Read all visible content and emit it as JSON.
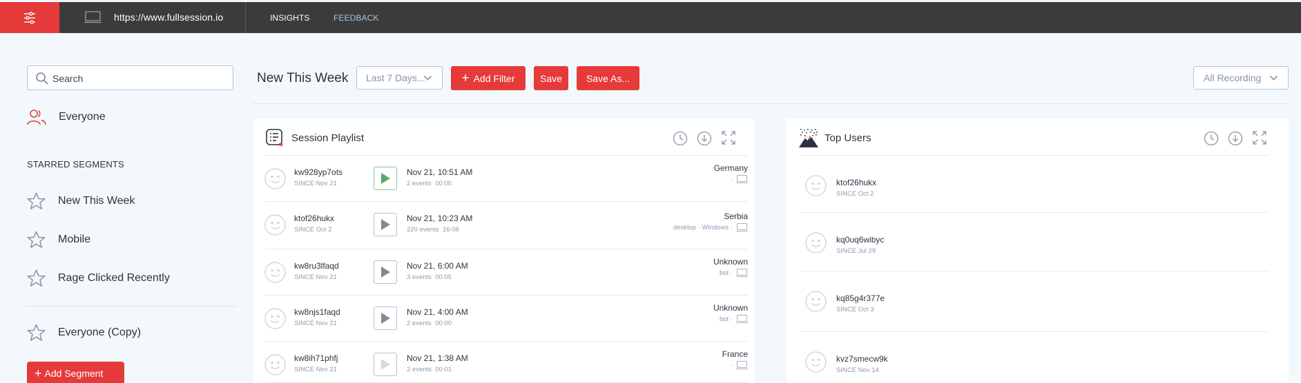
{
  "topbar": {
    "url": "https://www.fullsession.io",
    "tabs": [
      "INSIGHTS",
      "FEEDBACK"
    ]
  },
  "sidebar": {
    "search_placeholder": "Search",
    "everyone_label": "Everyone",
    "starred_heading": "STARRED SEGMENTS",
    "starred": [
      "New This Week",
      "Mobile",
      "Rage Clicked Recently"
    ],
    "other": [
      "Everyone (Copy)"
    ],
    "add_segment_label": "Add Segment"
  },
  "toolbar": {
    "title": "New This Week",
    "date_range": "Last 7 Days...",
    "add_filter_label": "Add Filter",
    "save_label": "Save",
    "save_as_label": "Save As...",
    "recording_filter": "All Recording"
  },
  "session_playlist": {
    "title": "Session Playlist",
    "rows": [
      {
        "user": "kw928yp7ots",
        "since": "SINCE Nov 21",
        "time": "Nov 21, 10:51 AM",
        "events": "2 events  00:00",
        "country": "Germany",
        "device": "·",
        "active": true
      },
      {
        "user": "ktof26hukx",
        "since": "SINCE Oct 2",
        "time": "Nov 21, 10:23 AM",
        "events": "220 events  16:08",
        "country": "Serbia",
        "device": "desktop · Windows ·",
        "active": false
      },
      {
        "user": "kw8ru3lfaqd",
        "since": "SINCE Nov 21",
        "time": "Nov 21, 6:00 AM",
        "events": "3 events  00:05",
        "country": "Unknown",
        "device": "bot ·",
        "active": false
      },
      {
        "user": "kw8njs1faqd",
        "since": "SINCE Nov 21",
        "time": "Nov 21, 4:00 AM",
        "events": "2 events  00:00",
        "country": "Unknown",
        "device": "bot ·",
        "active": false
      },
      {
        "user": "kw8ih71phfj",
        "since": "SINCE Nov 21",
        "time": "Nov 21, 1:38 AM",
        "events": "2 events  00:01",
        "country": "France",
        "device": "·",
        "active": false
      }
    ]
  },
  "top_users": {
    "title": "Top Users",
    "rows": [
      {
        "user": "ktof26hukx",
        "since": "SINCE Oct 2"
      },
      {
        "user": "kq0uq6wibyc",
        "since": "SINCE Jul 29"
      },
      {
        "user": "kq85g4r377e",
        "since": "SINCE Oct 3"
      },
      {
        "user": "kvz7smecw9k",
        "since": "SINCE Nov 14"
      }
    ]
  },
  "colors": {
    "brand_red": "#e63a3a",
    "topbar_bg": "#3b3b3b",
    "page_bg": "#f3f8fc",
    "play_active": "#5aa86a"
  }
}
